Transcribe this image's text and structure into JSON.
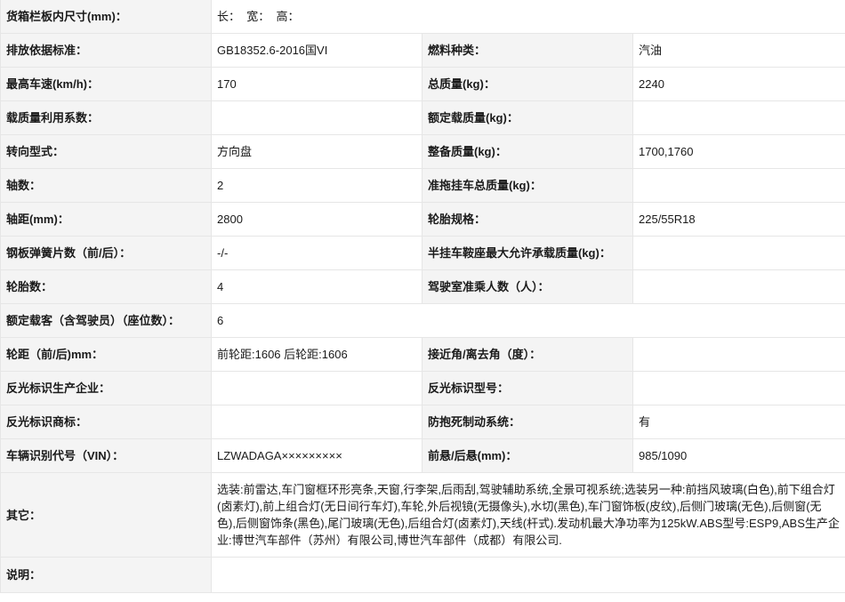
{
  "rows": [
    {
      "label": "货箱栏板内尺寸(mm)：",
      "value": "长：  宽：  高："
    },
    {
      "label1": "排放依据标准：",
      "value1": "GB18352.6-2016国VI",
      "label2": "燃料种类：",
      "value2": "汽油"
    },
    {
      "label1": "最高车速(km/h)：",
      "value1": "170",
      "label2": "总质量(kg)：",
      "value2": "2240"
    },
    {
      "label1": "载质量利用系数：",
      "value1": "",
      "label2": "额定载质量(kg)：",
      "value2": ""
    },
    {
      "label1": "转向型式：",
      "value1": "方向盘",
      "label2": "整备质量(kg)：",
      "value2": "1700,1760"
    },
    {
      "label1": "轴数：",
      "value1": "2",
      "label2": "准拖挂车总质量(kg)：",
      "value2": ""
    },
    {
      "label1": "轴距(mm)：",
      "value1": "2800",
      "label2": "轮胎规格：",
      "value2": "225/55R18"
    },
    {
      "label1": "钢板弹簧片数（前/后）：",
      "value1": "-/-",
      "label2": "半挂车鞍座最大允许承载质量(kg)：",
      "value2": ""
    },
    {
      "label1": "轮胎数：",
      "value1": "4",
      "label2": "驾驶室准乘人数（人）：",
      "value2": ""
    },
    {
      "label": "额定载客（含驾驶员）（座位数）：",
      "value": "6"
    },
    {
      "label1": "轮距（前/后)mm：",
      "value1": "前轮距:1606 后轮距:1606",
      "label2": "接近角/离去角（度）：",
      "value2": ""
    },
    {
      "label1": "反光标识生产企业：",
      "value1": "",
      "label2": "反光标识型号：",
      "value2": ""
    },
    {
      "label1": "反光标识商标：",
      "value1": "",
      "label2": "防抱死制动系统：",
      "value2": "有"
    },
    {
      "label1": "车辆识别代号（VIN）：",
      "value1": "LZWADAGA×××××××××",
      "label2": "前悬/后悬(mm)：",
      "value2": "985/1090"
    },
    {
      "label": "其它：",
      "value": "选装:前雷达,车门窗框环形亮条,天窗,行李架,后雨刮,驾驶辅助系统,全景可视系统;选装另一种:前挡风玻璃(白色),前下组合灯(卤素灯),前上组合灯(无日间行车灯),车轮,外后视镜(无摄像头),水切(黑色),车门窗饰板(皮纹),后侧门玻璃(无色),后侧窗(无色),后侧窗饰条(黑色),尾门玻璃(无色),后组合灯(卤素灯),天线(杆式).发动机最大净功率为125kW.ABS型号:ESP9,ABS生产企业:博世汽车部件（苏州）有限公司,博世汽车部件（成都）有限公司."
    },
    {
      "label": "说明：",
      "value": ""
    }
  ]
}
